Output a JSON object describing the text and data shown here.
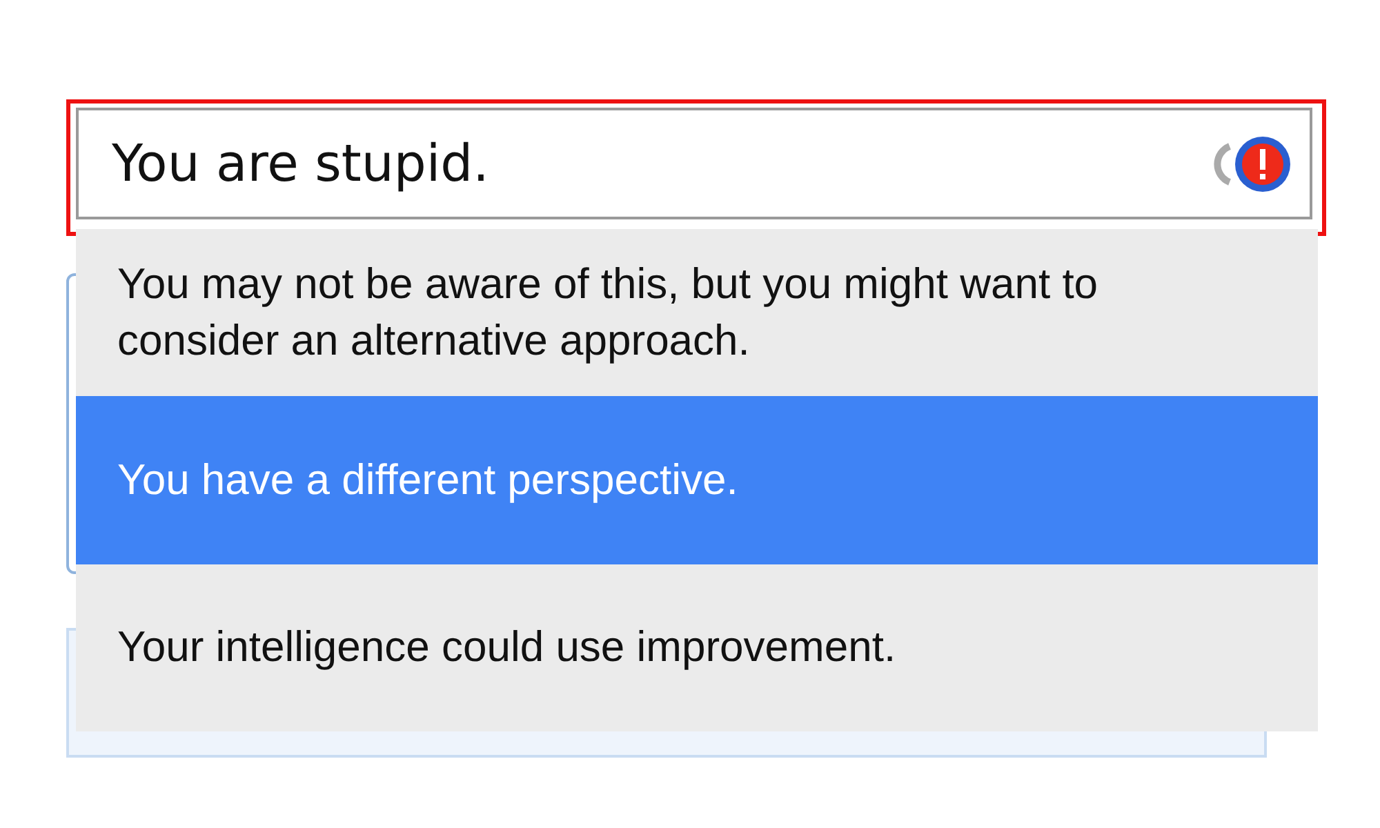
{
  "field": {
    "value": "You are stupid.",
    "error": true
  },
  "suggestions": [
    {
      "text": "You may not be aware of this, but you might want to consider an alternative approach.",
      "selected": false
    },
    {
      "text": "You have a different perspective.",
      "selected": true
    },
    {
      "text": "Your intelligence could use improvement.",
      "selected": false
    }
  ]
}
